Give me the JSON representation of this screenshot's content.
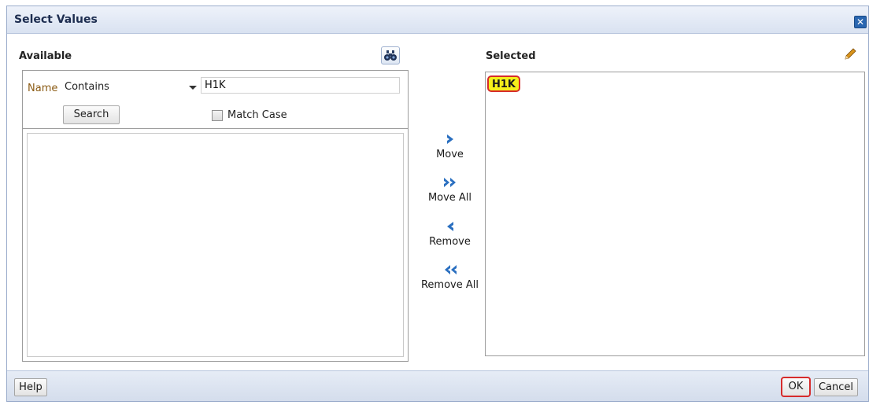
{
  "dialog": {
    "title": "Select Values",
    "close_icon": "close-icon"
  },
  "available": {
    "label": "Available",
    "search_icon": "binoculars-icon",
    "filter": {
      "name_label": "Name",
      "operator": "Contains",
      "value": "H1K",
      "search_button": "Search",
      "match_case_label": "Match Case",
      "match_case_checked": false
    },
    "items": []
  },
  "shuttle": {
    "move": "Move",
    "move_all": "Move All",
    "remove": "Remove",
    "remove_all": "Remove All"
  },
  "selected": {
    "label": "Selected",
    "edit_icon": "pencil-icon",
    "items": [
      {
        "label": "H1K",
        "highlighted": true
      }
    ]
  },
  "footer": {
    "help_button": "Help",
    "ok_button": "OK",
    "cancel_button": "Cancel"
  },
  "colors": {
    "highlight_border": "#d62b2b",
    "highlight_fill": "#f5f01a",
    "shuttle_arrow": "#2a6fc0"
  }
}
